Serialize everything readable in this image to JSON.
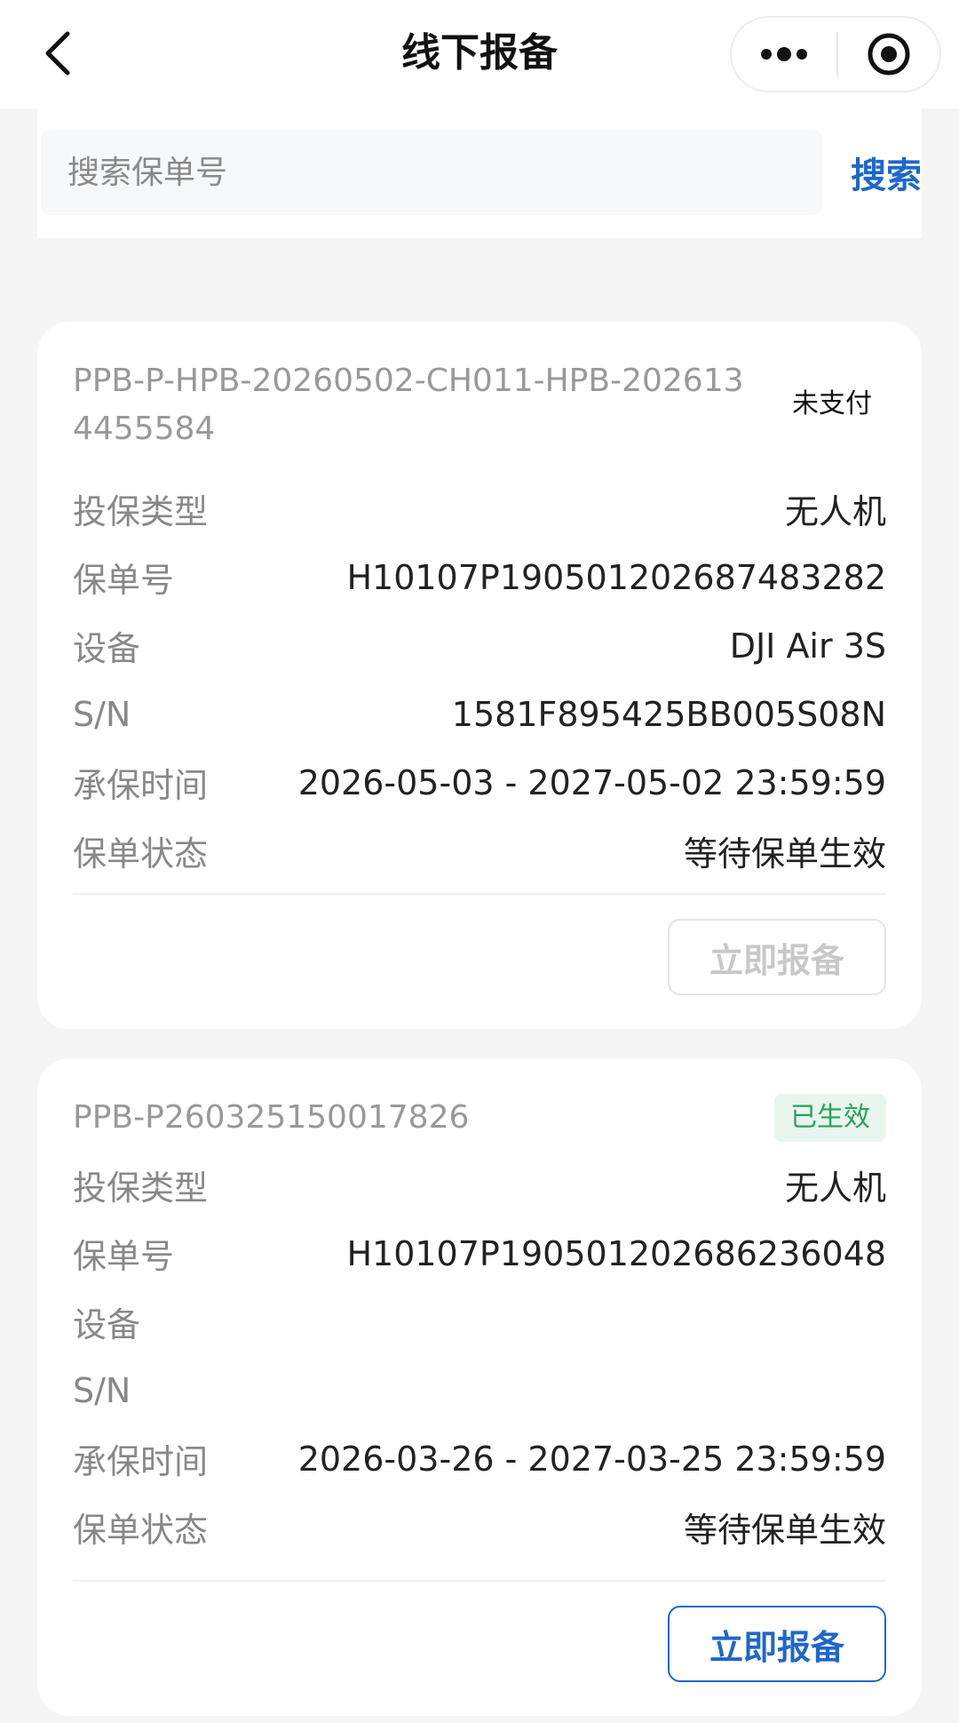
{
  "navbar": {
    "title": "线下报备",
    "back_icon": "chevron-left-icon",
    "more_icon": "more-dots-icon",
    "close_icon": "target-close-icon"
  },
  "search": {
    "placeholder": "搜索保单号",
    "value": "",
    "button_label": "搜索"
  },
  "colors": {
    "accent": "#1f67c9",
    "active_status": "#27a15a",
    "active_status_bg": "#e8f6ee"
  },
  "policies": [
    {
      "order_no": "PPB-P-HPB-20260502-CH011-HPB-2026134455584",
      "status": "未支付",
      "fields": [
        {
          "label": "投保类型",
          "value": "无人机"
        },
        {
          "label": "保单号",
          "value": "H10107P190501202687483282"
        },
        {
          "label": "设备",
          "value": "DJI Air 3S"
        },
        {
          "label": "S/N",
          "value": "1581F895425BB005S08N"
        },
        {
          "label": "承保时间",
          "value": "2026-05-03 - 2027-05-02 23:59:59"
        },
        {
          "label": "保单状态",
          "value": "等待保单生效"
        }
      ],
      "action_label": "立即报备",
      "action_enabled": false
    },
    {
      "order_no": "PPB-P260325150017826",
      "status": "已生效",
      "fields": [
        {
          "label": "投保类型",
          "value": "无人机"
        },
        {
          "label": "保单号",
          "value": "H10107P190501202686236048"
        },
        {
          "label": "设备",
          "value": ""
        },
        {
          "label": "S/N",
          "value": ""
        },
        {
          "label": "承保时间",
          "value": "2026-03-26 - 2027-03-25 23:59:59"
        },
        {
          "label": "保单状态",
          "value": "等待保单生效"
        }
      ],
      "action_label": "立即报备",
      "action_enabled": true
    }
  ]
}
